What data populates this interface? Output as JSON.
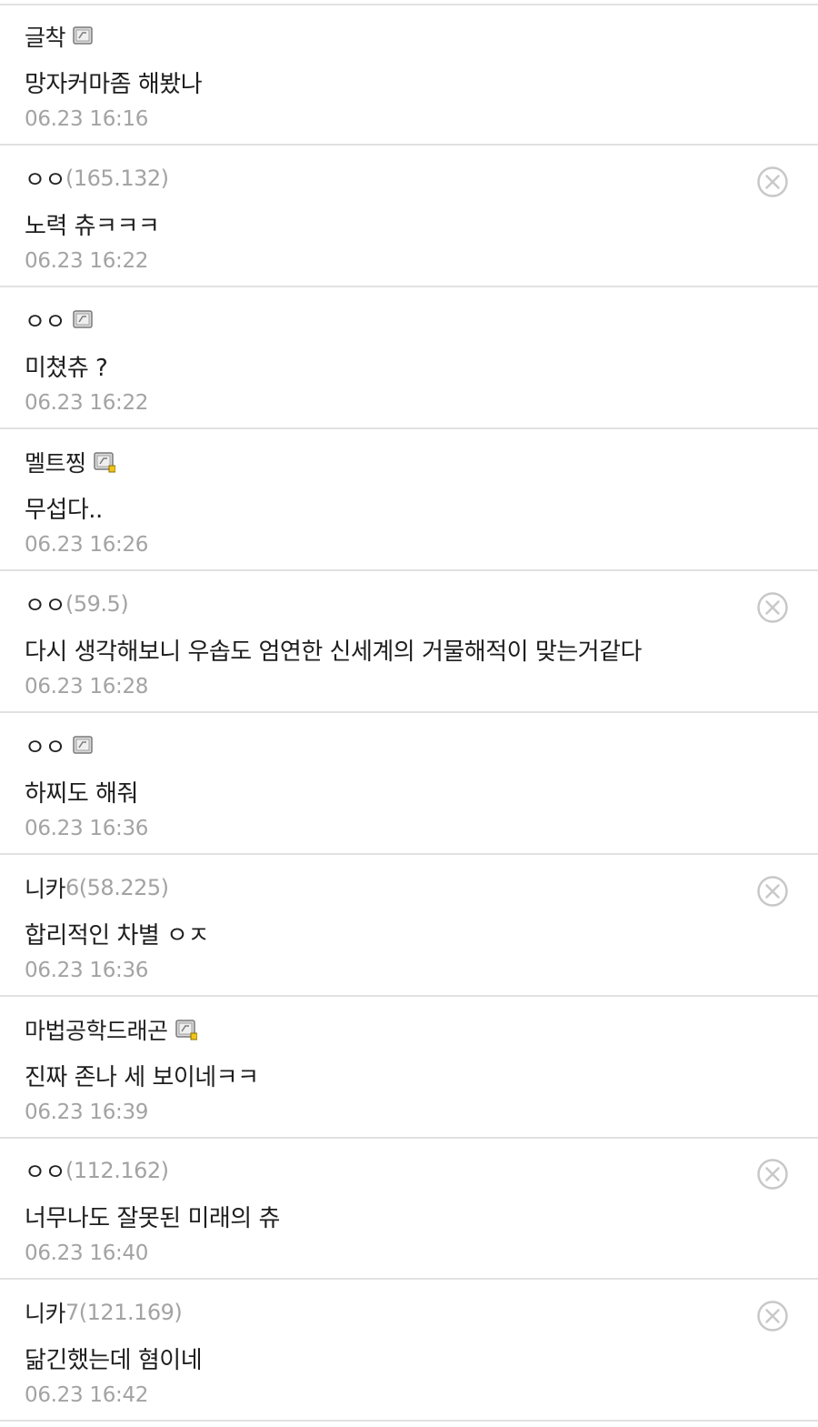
{
  "comments": [
    {
      "nick": "글착",
      "ip": "",
      "badge": "fixed-gallog-icon",
      "text": "망자커마좀 해봤나",
      "date": "06.23 16:16",
      "deletable": false
    },
    {
      "nick": "ㅇㅇ",
      "ip": "(165.132)",
      "badge": "",
      "text": "노력 츄ㅋㅋㅋ",
      "date": "06.23 16:22",
      "deletable": true
    },
    {
      "nick": "ㅇㅇ",
      "ip": "",
      "badge": "fixed-gallog-icon",
      "text": "미쳤츄 ?",
      "date": "06.23 16:22",
      "deletable": false
    },
    {
      "nick": "멜트찡",
      "ip": "",
      "badge": "new-gallog-icon",
      "text": "무섭다..",
      "date": "06.23 16:26",
      "deletable": false
    },
    {
      "nick": "ㅇㅇ",
      "ip": "(59.5)",
      "badge": "",
      "text": "다시 생각해보니 우솝도 엄연한 신세계의 거물해적이 맞는거같다",
      "date": "06.23 16:28",
      "deletable": true
    },
    {
      "nick": "ㅇㅇ",
      "ip": "",
      "badge": "fixed-gallog-icon",
      "text": "하찌도 해줘",
      "date": "06.23 16:36",
      "deletable": false
    },
    {
      "nick": "니카",
      "ip": "6(58.225)",
      "badge": "",
      "text": "합리적인 차별 ㅇㅈ",
      "date": "06.23 16:36",
      "deletable": true
    },
    {
      "nick": "마법공학드래곤",
      "ip": "",
      "badge": "new-gallog-icon",
      "text": "진짜 존나 세 보이네ㅋㅋ",
      "date": "06.23 16:39",
      "deletable": false
    },
    {
      "nick": "ㅇㅇ",
      "ip": "(112.162)",
      "badge": "",
      "text": "너무나도 잘못된 미래의 츄",
      "date": "06.23 16:40",
      "deletable": true
    },
    {
      "nick": "니카",
      "ip": "7(121.169)",
      "badge": "",
      "text": "닮긴했는데 혐이네",
      "date": "06.23 16:42",
      "deletable": true
    }
  ],
  "icons": {
    "delete": "close-circle-icon"
  },
  "colors": {
    "divider": "#e1e1e1",
    "meta_gray": "#a3a3a3",
    "badge_accent": "#f0c419",
    "delete_icon": "#c8c8c8"
  }
}
